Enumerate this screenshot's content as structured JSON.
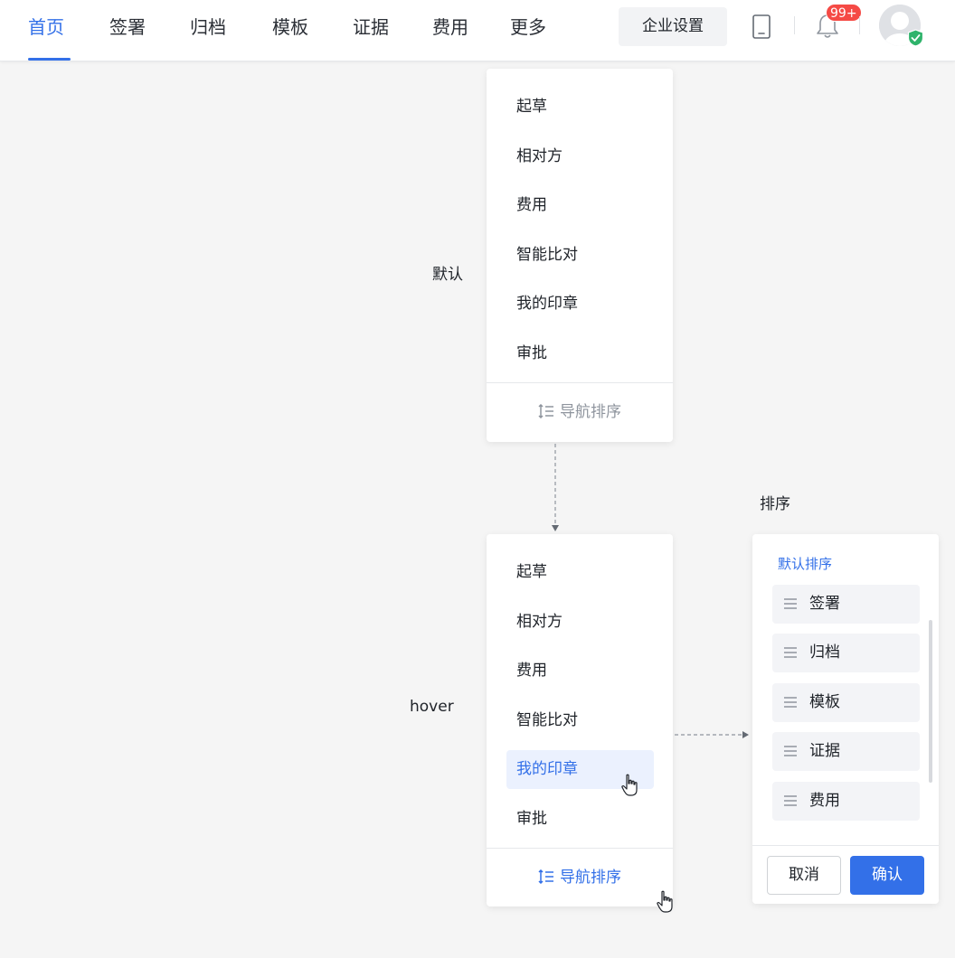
{
  "nav": {
    "tabs": [
      {
        "label": "首页",
        "active": true
      },
      {
        "label": "签署"
      },
      {
        "label": "归档"
      },
      {
        "label": "模板"
      },
      {
        "label": "证据"
      },
      {
        "label": "费用"
      },
      {
        "label": "更多"
      }
    ],
    "enterprise_settings": "企业设置",
    "notification_badge": "99+",
    "icons": [
      "phone-icon",
      "bell-icon",
      "avatar",
      "verified-check-icon"
    ]
  },
  "states": {
    "default_label": "默认",
    "hover_label": "hover",
    "sort_label": "排序"
  },
  "menu": {
    "items": [
      "起草",
      "相对方",
      "费用",
      "智能比对",
      "我的印章",
      "审批"
    ],
    "hovered_item": "我的印章",
    "sort_link": "导航排序"
  },
  "sort_panel": {
    "title": "默认排序",
    "items": [
      "签署",
      "归档",
      "模板",
      "证据",
      "费用"
    ],
    "cancel": "取消",
    "confirm": "确认"
  },
  "colors": {
    "accent": "#3370e8",
    "badge": "#f54a45",
    "hover_bg": "#ebf1fe",
    "verified": "#2fb36b"
  }
}
